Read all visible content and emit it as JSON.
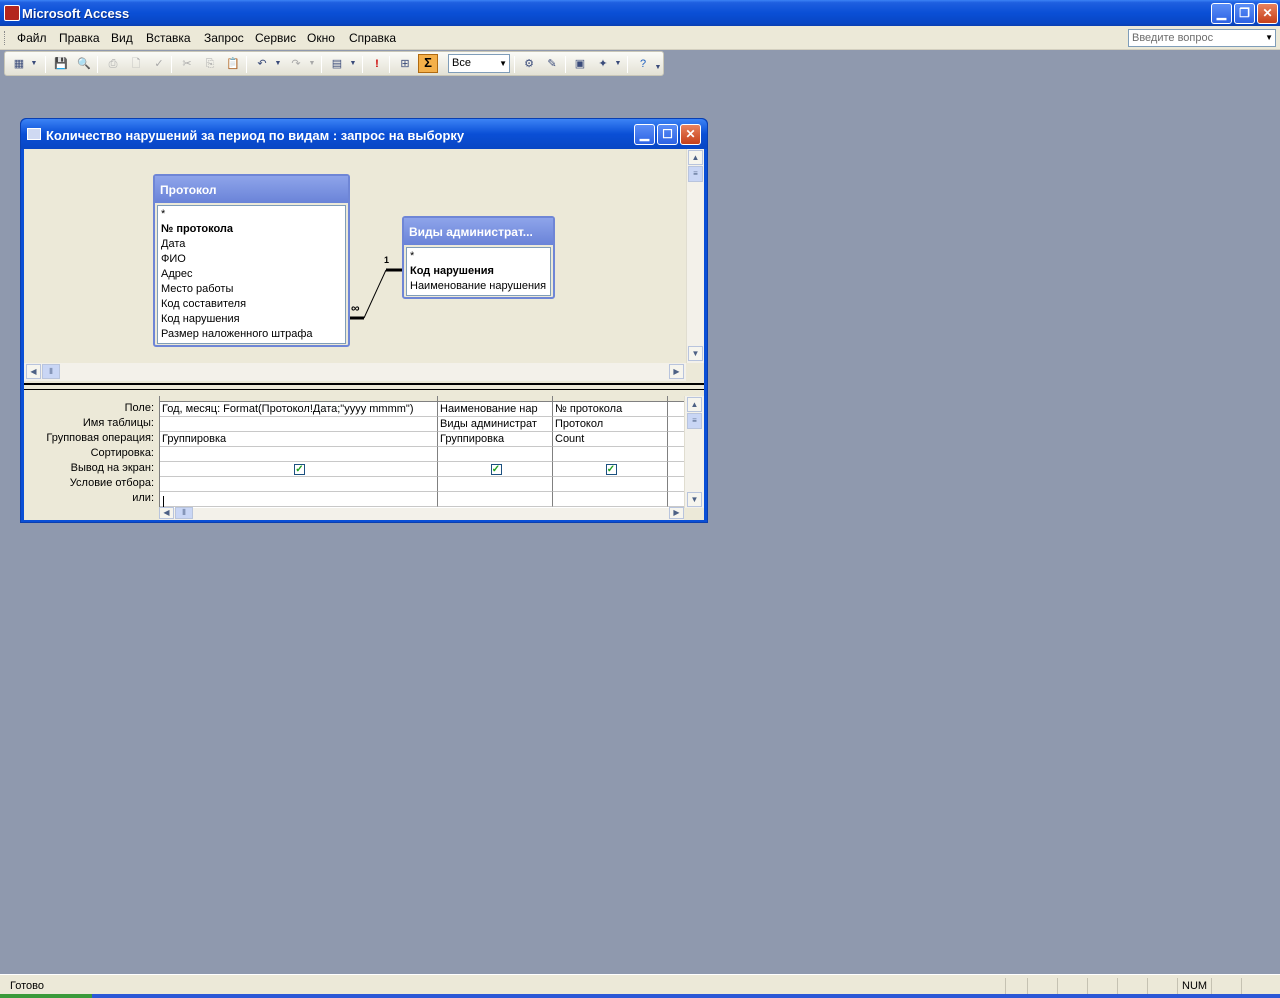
{
  "app": {
    "title": "Microsoft Access"
  },
  "menu": {
    "items": [
      "Файл",
      "Правка",
      "Вид",
      "Вставка",
      "Запрос",
      "Сервис",
      "Окно",
      "Справка"
    ],
    "help_placeholder": "Введите вопрос"
  },
  "toolbar": {
    "combo_value": "Все"
  },
  "query_window": {
    "title": "Количество нарушений за период по видам : запрос на выборку"
  },
  "tables": [
    {
      "name": "Протокол",
      "fields": [
        {
          "label": "*",
          "key": false
        },
        {
          "label": "№ протокола",
          "key": true
        },
        {
          "label": "Дата",
          "key": false
        },
        {
          "label": "ФИО",
          "key": false
        },
        {
          "label": "Адрес",
          "key": false
        },
        {
          "label": "Место работы",
          "key": false
        },
        {
          "label": "Код составителя",
          "key": false
        },
        {
          "label": "Код нарушения",
          "key": false
        },
        {
          "label": "Размер наложенного штрафа",
          "key": false
        }
      ]
    },
    {
      "name": "Виды администрат...",
      "fields": [
        {
          "label": "*",
          "key": false
        },
        {
          "label": "Код нарушения",
          "key": true
        },
        {
          "label": "Наименование нарушения",
          "key": false
        }
      ]
    }
  ],
  "relationship": {
    "one_label": "1",
    "many_label": "∞"
  },
  "grid": {
    "row_labels": [
      "Поле:",
      "Имя таблицы:",
      "Групповая операция:",
      "Сортировка:",
      "Вывод на экран:",
      "Условие отбора:",
      "или:"
    ],
    "columns": [
      {
        "field": "Год, месяц: Format(Протокол!Дата;\"yyyy mmmm\")",
        "table": "",
        "total": "Группировка",
        "sort": "",
        "show": true,
        "criteria": "",
        "or": ""
      },
      {
        "field": "Наименование нар",
        "table": "Виды администрат",
        "total": "Группировка",
        "sort": "",
        "show": true,
        "criteria": "",
        "or": ""
      },
      {
        "field": "№ протокола",
        "table": "Протокол",
        "total": "Count",
        "sort": "",
        "show": true,
        "criteria": "",
        "or": ""
      }
    ]
  },
  "status": {
    "text": "Готово",
    "num": "NUM"
  }
}
